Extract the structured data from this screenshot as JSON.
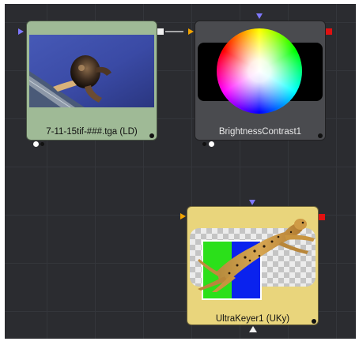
{
  "nodes": {
    "loader": {
      "label": "7-11-15tif-###.tga  (LD)"
    },
    "brightness": {
      "label": "BrightnessContrast1"
    },
    "keyer": {
      "label": "UltraKeyer1  (UKy)"
    }
  },
  "colors": {
    "canvas_bg": "#2b2c30",
    "loader_node": "#9fba96",
    "brightness_node": "#4a4b4f",
    "keyer_node": "#e9d57c",
    "input_triangle": "#f2a400",
    "mask_triangle": "#7f78ff",
    "output_square": "#e01111",
    "connected_output": "#f0f0f0"
  },
  "icons": {
    "loader_thumbnail": "astronaut-photo-thumbnail",
    "brightness_thumbnail": "color-wheel-thumbnail",
    "keyer_thumbnail": "cheetah-keyed-thumbnail"
  }
}
